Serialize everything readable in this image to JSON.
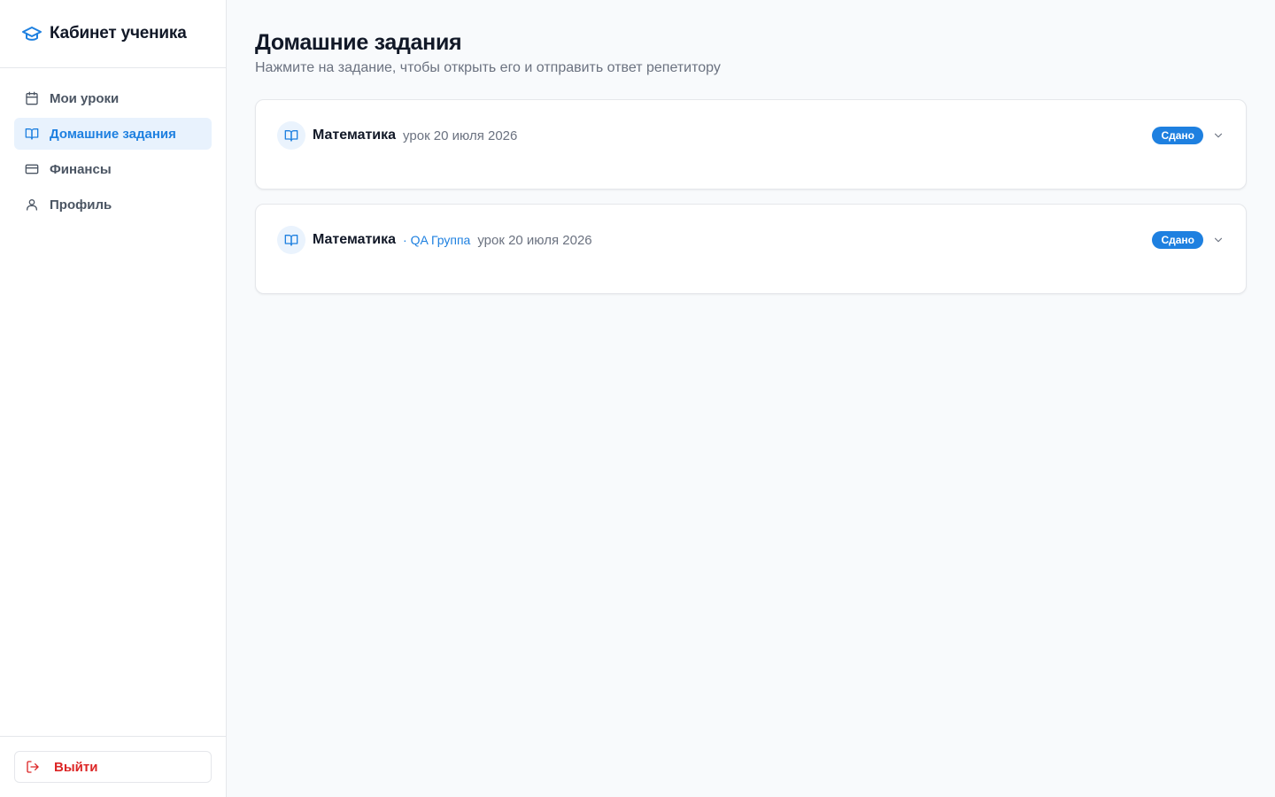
{
  "sidebar": {
    "brand_title": "Кабинет ученика",
    "brand_icon": "graduation-cap-icon",
    "items": [
      {
        "label": "Мои уроки",
        "icon": "calendar-icon",
        "active": false
      },
      {
        "label": "Домашние задания",
        "icon": "book-open-icon",
        "active": true
      },
      {
        "label": "Финансы",
        "icon": "credit-card-icon",
        "active": false
      },
      {
        "label": "Профиль",
        "icon": "user-icon",
        "active": false
      }
    ],
    "logout_label": "Выйти",
    "logout_icon": "log-out-icon"
  },
  "main": {
    "title": "Домашние задания",
    "subtitle": "Нажмите на задание, чтобы открыть его и отправить ответ репетитору",
    "homeworks": [
      {
        "subject": "Математика",
        "group": "",
        "date": "урок 20 июля 2026",
        "status": "Сдано"
      },
      {
        "subject": "Математика",
        "group": "· QA Группа",
        "date": "урок 20 июля 2026",
        "status": "Сдано"
      }
    ]
  },
  "colors": {
    "accent": "#1e80e0",
    "danger": "#dc2626",
    "active_bg": "#e8f2fd"
  }
}
